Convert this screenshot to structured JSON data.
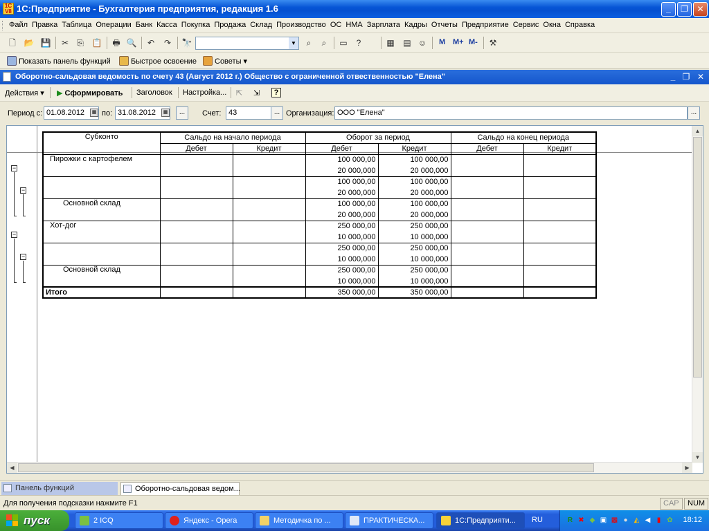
{
  "app": {
    "title": "1С:Предприятие - Бухгалтерия предприятия, редакция 1.6",
    "logo_text": "1С V8"
  },
  "menu": [
    "Файл",
    "Правка",
    "Таблица",
    "Операции",
    "Банк",
    "Касса",
    "Покупка",
    "Продажа",
    "Склад",
    "Производство",
    "ОС",
    "НМА",
    "Зарплата",
    "Кадры",
    "Отчеты",
    "Предприятие",
    "Сервис",
    "Окна",
    "Справка"
  ],
  "toolbar": {
    "m_labels": [
      "M",
      "M+",
      "M-"
    ]
  },
  "panel_toolbar": {
    "show_panel": "Показать панель функций",
    "quick_learn": "Быстрое освоение",
    "tips": "Советы"
  },
  "report_window": {
    "title": "Оборотно-сальдовая ведомость по счету 43 (Август 2012 г.) Общество с ограниченной отвественностью \"Елена\"",
    "actions": {
      "actions_label": "Действия",
      "form_label": "Сформировать",
      "header_label": "Заголовок",
      "settings_label": "Настройка..."
    },
    "filters": {
      "period_from_label": "Период с:",
      "period_from": "01.08.2012",
      "period_to_label": "по:",
      "period_to": "31.08.2012",
      "account_label": "Счет:",
      "account": "43",
      "org_label": "Организация:",
      "org": "ООО \"Елена\""
    }
  },
  "table": {
    "headers": {
      "subkonto": "Субконто",
      "open_balance": "Сальдо на начало периода",
      "turnover": "Оборот за период",
      "close_balance": "Сальдо на конец периода",
      "debit": "Дебет",
      "credit": "Кредит"
    },
    "rows": [
      {
        "name": "Пирожки с картофелем",
        "indent": 0,
        "t_debit": [
          "100 000,00",
          "20 000,000"
        ],
        "t_credit": [
          "100 000,00",
          "20 000,000"
        ]
      },
      {
        "name": "",
        "indent": 1,
        "t_debit": [
          "100 000,00",
          "20 000,000"
        ],
        "t_credit": [
          "100 000,00",
          "20 000,000"
        ]
      },
      {
        "name": "Основной склад",
        "indent": 2,
        "t_debit": [
          "100 000,00",
          "20 000,000"
        ],
        "t_credit": [
          "100 000,00",
          "20 000,000"
        ]
      },
      {
        "name": "Хот-дог",
        "indent": 0,
        "t_debit": [
          "250 000,00",
          "10 000,000"
        ],
        "t_credit": [
          "250 000,00",
          "10 000,000"
        ]
      },
      {
        "name": "",
        "indent": 1,
        "t_debit": [
          "250 000,00",
          "10 000,000"
        ],
        "t_credit": [
          "250 000,00",
          "10 000,000"
        ]
      },
      {
        "name": "Основной склад",
        "indent": 2,
        "t_debit": [
          "250 000,00",
          "10 000,000"
        ],
        "t_credit": [
          "250 000,00",
          "10 000,000"
        ]
      }
    ],
    "total": {
      "name": "Итого",
      "t_debit": "350 000,00",
      "t_credit": "350 000,00"
    }
  },
  "window_tabs": [
    "Панель функций",
    "Оборотно-сальдовая ведом..."
  ],
  "status": {
    "hint": "Для получения подсказки нажмите F1",
    "cap": "CAP",
    "num": "NUM"
  },
  "taskbar": {
    "start": "пуск",
    "tasks": [
      "2 ICQ",
      "Яндекс - Opera",
      "Методичка по ...",
      "ПРАКТИЧЕСКА...",
      "1С:Предприяти..."
    ],
    "lang": "RU",
    "clock": "18:12"
  },
  "colors": {
    "title_blue": "#0856d6",
    "start_green": "#37922b",
    "form_icon_green": "#1a8a1a"
  }
}
